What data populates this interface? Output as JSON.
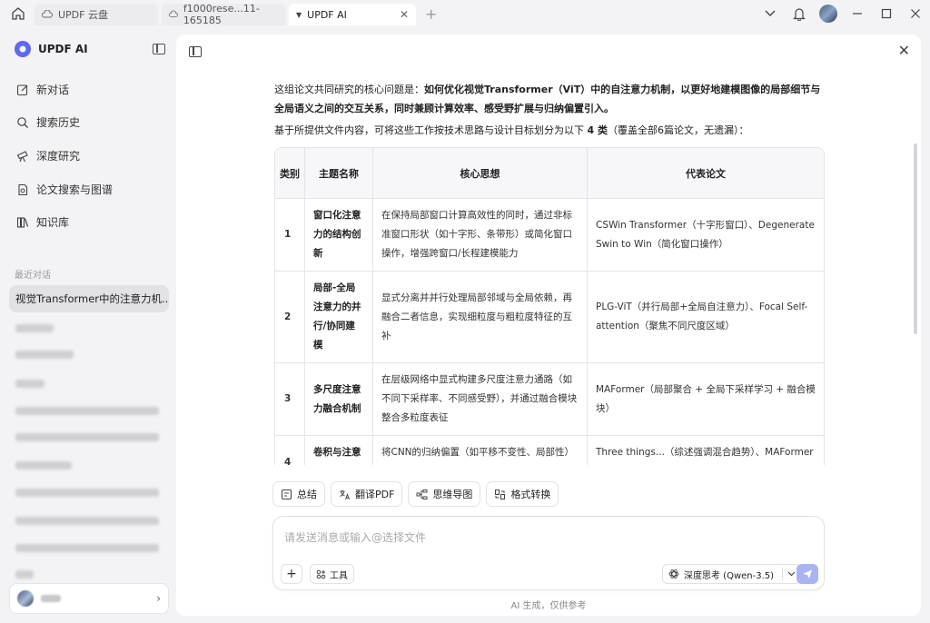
{
  "titlebar": {
    "tabs": [
      {
        "label": "UPDF 云盘",
        "icon": "cloud-icon"
      },
      {
        "label": "f1000rese...11-165185",
        "icon": "document-icon"
      },
      {
        "label": "UPDF AI",
        "icon": "ai-icon",
        "active": true
      }
    ],
    "add_tab": "+"
  },
  "sidebar": {
    "brand": "UPDF AI",
    "nav": [
      {
        "label": "新对话",
        "icon": "edit-icon"
      },
      {
        "label": "搜索历史",
        "icon": "search-icon"
      },
      {
        "label": "深度研究",
        "icon": "telescope-icon"
      },
      {
        "label": "论文搜索与图谱",
        "icon": "paper-search-icon"
      },
      {
        "label": "知识库",
        "icon": "library-icon"
      }
    ],
    "recent_label": "最近对话",
    "recent_active": "视觉Transformer中的注意力机...",
    "user_card_icon": "chevron-right-icon"
  },
  "content": {
    "intro_prefix": "这组论文共同研究的核心问题是：",
    "intro_bold": "如何优化视觉Transformer（ViT）中的自注意力机制，以更好地建模图像的局部细节与全局语义之间的交互关系，同时兼顾计算效率、感受野扩展与归纳偏置引入。",
    "summary_prefix": "基于所提供文件内容，可将这些工作按技术思路与设计目标划分为以下 ",
    "summary_bold": "4 类",
    "summary_suffix": "（覆盖全部6篇论文，无遗漏）：",
    "table": {
      "headers": [
        "类别",
        "主题名称",
        "核心思想",
        "代表论文"
      ],
      "rows": [
        {
          "num": "1",
          "theme": "窗口化注意力的结构创新",
          "idea": "在保持局部窗口计算高效性的同时，通过非标准窗口形状（如十字形、条带形）或简化窗口操作，增强跨窗口/长程建模能力",
          "papers": "CSWin Transformer（十字形窗口）、Degenerate Swin to Win（简化窗口操作）"
        },
        {
          "num": "2",
          "theme": "局部-全局注意力的并行/协同建模",
          "idea": "显式分离并并行处理局部邻域与全局依赖，再融合二者信息，实现细粒度与粗粒度特征的互补",
          "papers": "PLG-ViT（并行局部+全局自注意力）、Focal Self-attention（聚焦不同尺度区域）"
        },
        {
          "num": "3",
          "theme": "多尺度注意力融合机制",
          "idea": "在层级网络中显式构建多尺度注意力通路（如不同下采样率、不同感受野），并通过融合模块整合多粒度表征",
          "papers": "MAFormer（局部聚合 + 全局下采样学习 + 融合模块）"
        },
        {
          "num": "4",
          "theme": "卷积与注意力融合",
          "idea": "将CNN的归纳偏置（如平移不变性、局部性）融入Transformer架构，通过混合结构（卷积",
          "papers": "Three things...（综述强调混合趋势）、MAFormer（提及CvT/CoatNet等）"
        }
      ]
    }
  },
  "actions": [
    {
      "label": "总结",
      "icon": "summary-icon"
    },
    {
      "label": "翻译PDF",
      "icon": "translate-icon"
    },
    {
      "label": "思维导图",
      "icon": "mindmap-icon"
    },
    {
      "label": "格式转换",
      "icon": "convert-icon"
    }
  ],
  "input": {
    "placeholder": "请发送消息或输入@选择文件",
    "plus": "+",
    "tools_label": "工具",
    "model_label": "深度思考 (Qwen-3.5)"
  },
  "footer_note": "AI 生成，仅供参考",
  "colors": {
    "send_button": "#aab4f5",
    "brand_accent": "#4c7bf3"
  }
}
